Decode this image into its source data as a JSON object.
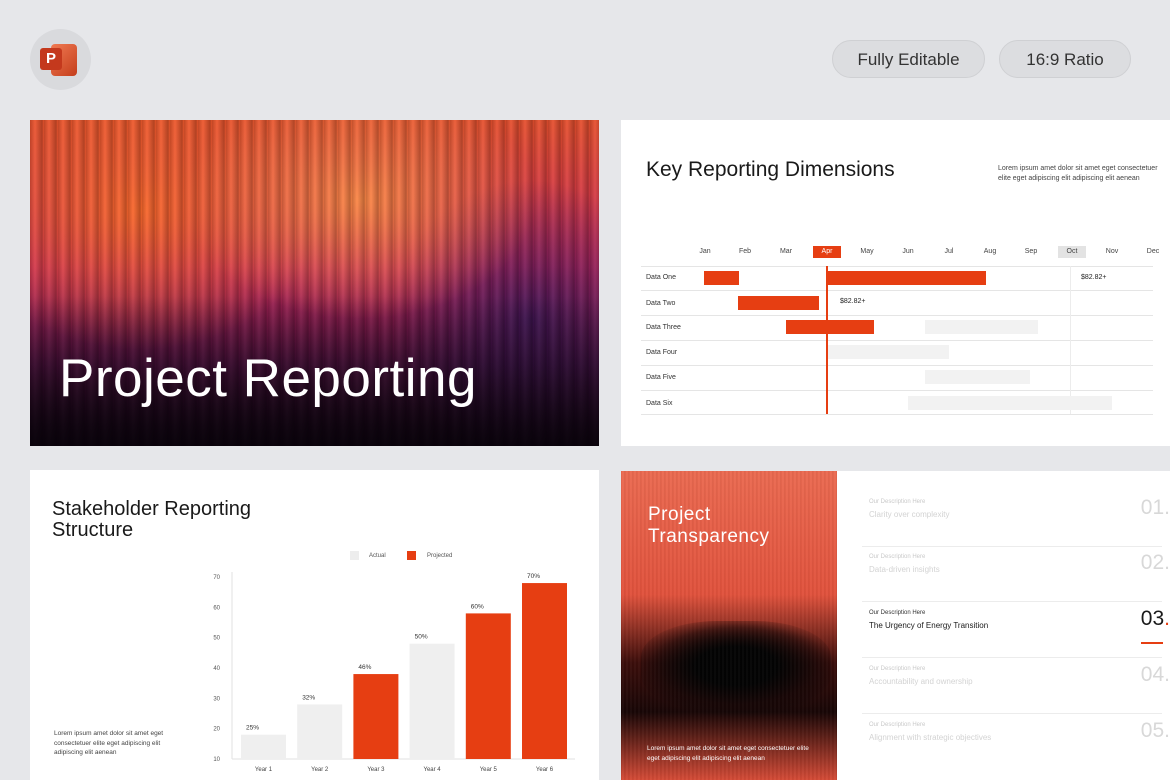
{
  "header": {
    "app_icon": "powerpoint-icon",
    "app_icon_letter": "P",
    "badges": [
      "Fully Editable",
      "16:9 Ratio"
    ]
  },
  "colors": {
    "accent": "#e63e12",
    "background": "#e6e7ea",
    "muted_bar": "#f2f2f2"
  },
  "slide1": {
    "title": "Project Reporting"
  },
  "slide2": {
    "title": "Key Reporting Dimensions",
    "description": "Lorem ipsum amet dolor sit amet eget consectetuer elite eget adipiscing elit adipiscing elit aenean",
    "months": [
      "Jan",
      "Feb",
      "Mar",
      "Apr",
      "May",
      "Jun",
      "Jul",
      "Aug",
      "Sep",
      "Oct",
      "Nov",
      "Dec"
    ],
    "highlighted_month": "Apr",
    "shaded_month": "Oct",
    "rows": [
      "Data One",
      "Data Two",
      "Data Three",
      "Data Four",
      "Data Five",
      "Data Six"
    ],
    "value_labels": [
      "$82.82+",
      "$82.82+"
    ]
  },
  "slide3": {
    "title": "Stakeholder Reporting Structure",
    "description": "Lorem ipsum amet dolor sit amet eget consectetuer elite eget adipiscing elit adipiscing elit aenean",
    "legend": [
      "Actual",
      "Projected"
    ]
  },
  "chart_data": {
    "type": "bar",
    "categories": [
      "Year 1",
      "Year 2",
      "Year 3",
      "Year 4",
      "Year 5",
      "Year 6"
    ],
    "values": [
      18,
      28,
      38,
      48,
      58,
      68
    ],
    "data_labels": [
      "25%",
      "32%",
      "46%",
      "50%",
      "60%",
      "70%"
    ],
    "series_type": [
      "Actual",
      "Actual",
      "Projected",
      "Actual",
      "Projected",
      "Projected"
    ],
    "ylim": [
      10,
      70
    ],
    "yticks": [
      10,
      20,
      30,
      40,
      50,
      60,
      70
    ],
    "legend": [
      "Actual",
      "Projected"
    ],
    "legend_position": "top",
    "colors": {
      "Actual": "#efefef",
      "Projected": "#e63e12"
    },
    "grid": false
  },
  "slide4": {
    "title": "Project Transparency",
    "description": "Lorem ipsum amet dolor sit amet eget consectetuer elite eget adipiscing elit adipiscing elit aenean",
    "items": [
      {
        "desc": "Our Description Here",
        "title": "Clarity over complexity",
        "num": "01."
      },
      {
        "desc": "Our Description Here",
        "title": "Data-driven insights",
        "num": "02."
      },
      {
        "desc": "Our Description Here",
        "title": "The Urgency of Energy Transition",
        "num": "03"
      },
      {
        "desc": "Our Description Here",
        "title": "Accountability and ownership",
        "num": "04."
      },
      {
        "desc": "Our Description Here",
        "title": "Alignment with strategic objectives",
        "num": "05."
      }
    ],
    "active_item_dot": "."
  }
}
